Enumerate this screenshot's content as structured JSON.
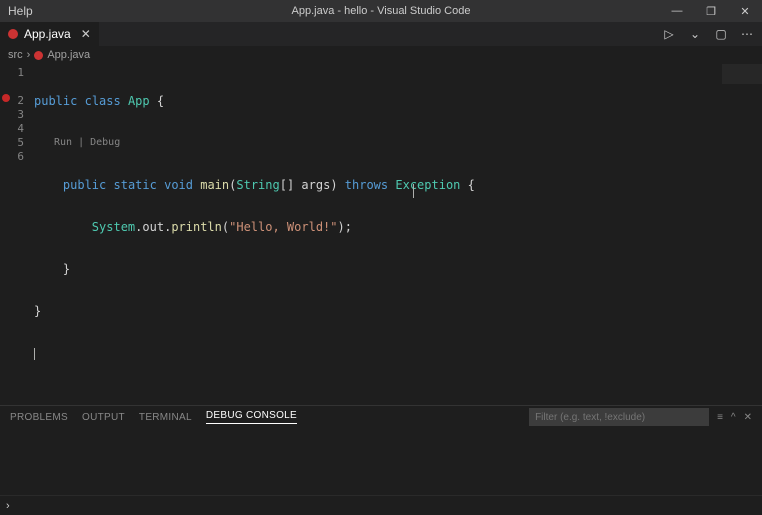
{
  "titlebar": {
    "menu_help": "Help",
    "title": "App.java - hello - Visual Studio Code"
  },
  "winctrl": {
    "min": "—",
    "max": "❐",
    "close": "✕"
  },
  "tab": {
    "label": "App.java",
    "close": "✕"
  },
  "tabactions": {
    "run": "▷",
    "run_chev": "⌄",
    "split": "▢",
    "more": "⋯"
  },
  "breadcrumb": {
    "seg1": "src",
    "sep": "›",
    "seg2": "App.java"
  },
  "gutter": {
    "l1": "1",
    "l2": "2",
    "l3": "3",
    "l4": "4",
    "l5": "5",
    "l6": "6"
  },
  "codelens": {
    "text": "Run | Debug"
  },
  "code": {
    "l1": {
      "a": "public",
      "b": "class",
      "c": "App",
      "d": "{"
    },
    "l2": {
      "a": "public",
      "b": "static",
      "c": "void",
      "d": "main",
      "e": "(",
      "f": "String",
      "g": "[] ",
      "h": "args",
      "i": ") ",
      "j": "throws",
      "k": "Exception",
      "l": " {"
    },
    "l3": {
      "a": "System",
      "b": ".",
      "c": "out",
      "d": ".",
      "e": "println",
      "f": "(",
      "g": "\"Hello, World!\"",
      "h": ");"
    },
    "l4": {
      "a": "}"
    },
    "l5": {
      "a": "}"
    }
  },
  "panel": {
    "problems": "PROBLEMS",
    "output": "OUTPUT",
    "terminal": "TERMINAL",
    "debug": "DEBUG CONSOLE",
    "filter_placeholder": "Filter (e.g. text, !exclude)",
    "ic_filter": "≡",
    "ic_up": "^",
    "ic_close": "✕"
  },
  "status": {
    "chev": "›"
  }
}
